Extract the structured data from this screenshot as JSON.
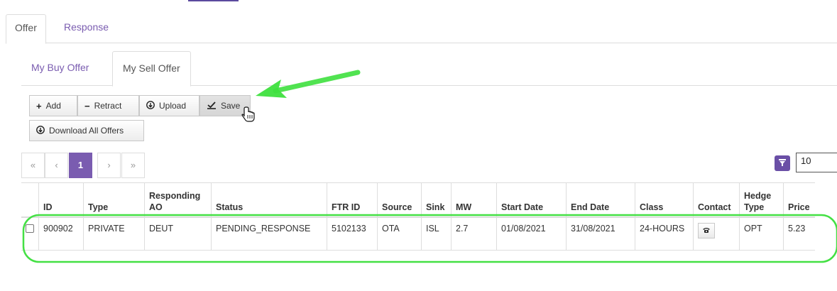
{
  "main_tabs": [
    {
      "label": "Offer",
      "active": true
    },
    {
      "label": "Response",
      "active": false
    }
  ],
  "sub_tabs": [
    {
      "label": "My Buy Offer",
      "active": false
    },
    {
      "label": "My Sell Offer",
      "active": true
    }
  ],
  "toolbar": {
    "add_label": "Add",
    "retract_label": "Retract",
    "upload_label": "Upload",
    "save_label": "Save",
    "download_label": "Download All Offers",
    "icons": {
      "add": "plus-icon",
      "retract": "minus-icon",
      "upload": "circle-arrow-icon",
      "save": "save-icon",
      "download": "circle-arrow-icon"
    }
  },
  "pagination": {
    "first": "«",
    "prev": "‹",
    "current": "1",
    "next": "›",
    "last": "»"
  },
  "page_size": "10",
  "table": {
    "headers": {
      "id": "ID",
      "type": "Type",
      "responding_ao": "Responding AO",
      "status": "Status",
      "ftr_id": "FTR ID",
      "source": "Source",
      "sink": "Sink",
      "mw": "MW",
      "start_date": "Start Date",
      "end_date": "End Date",
      "class": "Class",
      "contact": "Contact",
      "hedge_type": "Hedge Type",
      "price": "Price"
    },
    "rows": [
      {
        "id": "900902",
        "type": "PRIVATE",
        "responding_ao": "DEUT",
        "status": "PENDING_RESPONSE",
        "ftr_id": "5102133",
        "source": "OTA",
        "sink": "ISL",
        "mw": "2.7",
        "start_date": "01/08/2021",
        "end_date": "31/08/2021",
        "class": "24-HOURS",
        "hedge_type": "OPT",
        "price": "5.23"
      }
    ]
  },
  "colors": {
    "accent": "#7a5cb0",
    "annotation": "#3ee03e"
  }
}
